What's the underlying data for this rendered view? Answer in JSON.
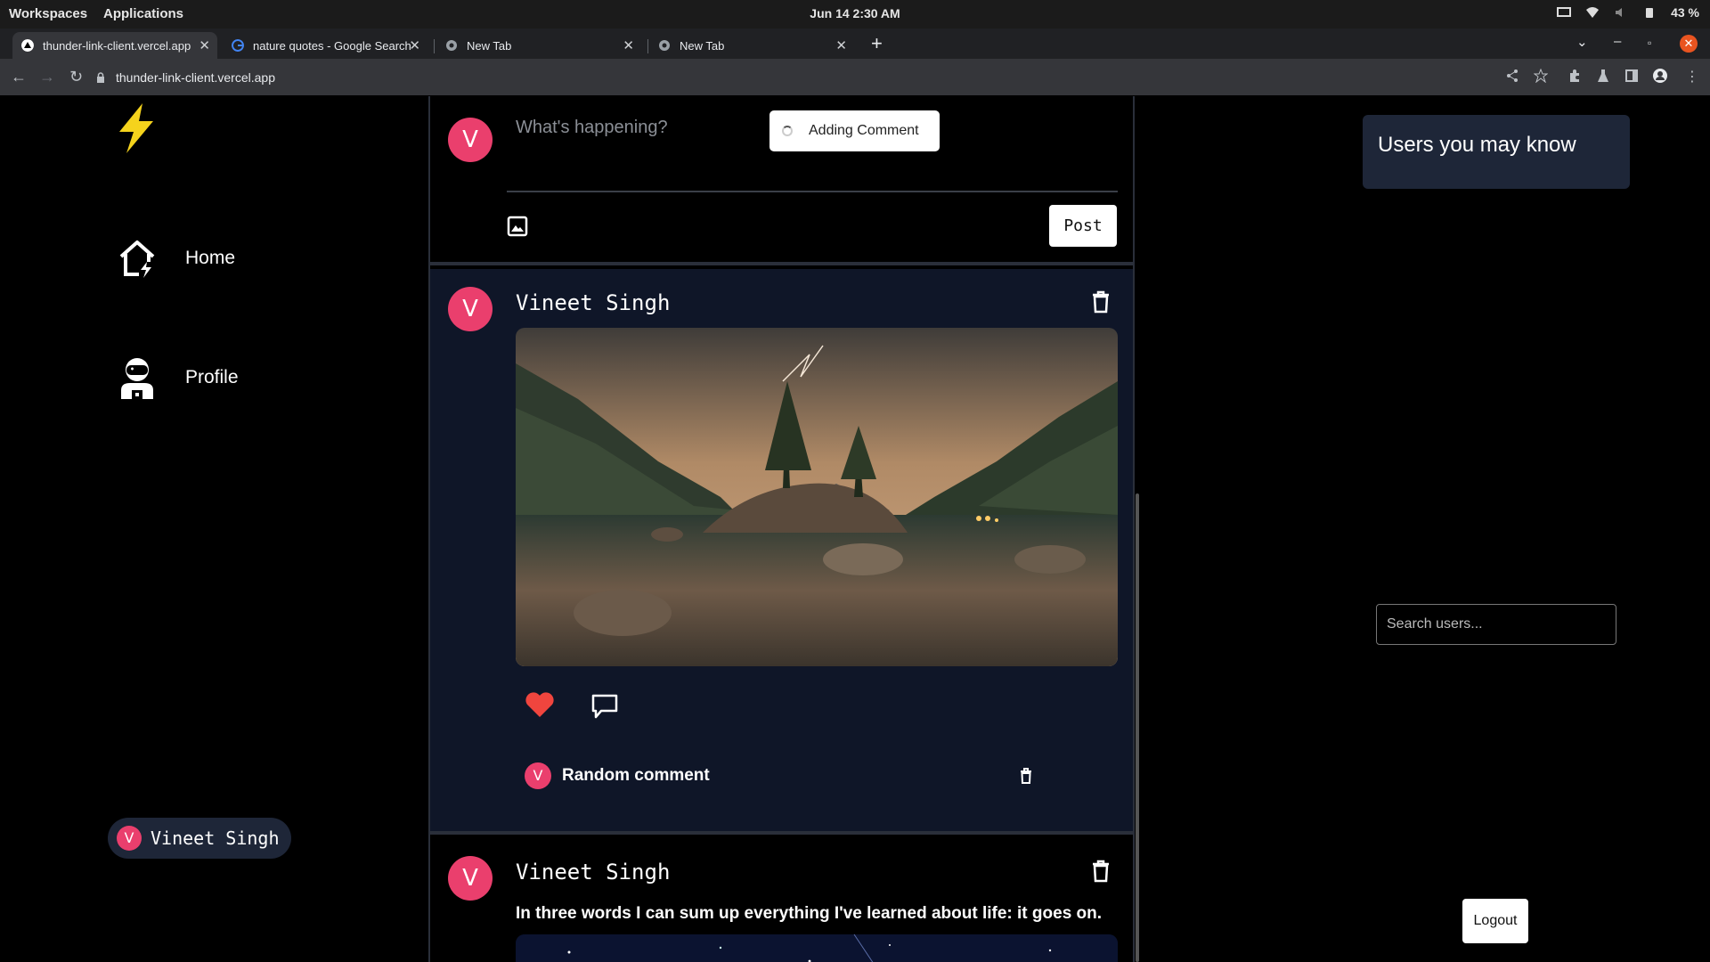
{
  "os_bar": {
    "workspaces": "Workspaces",
    "applications": "Applications",
    "clock": "Jun 14  2:30 AM",
    "battery": "43 %"
  },
  "browser": {
    "tabs": [
      {
        "title": "thunder-link-client.vercel.app",
        "active": true
      },
      {
        "title": "nature quotes - Google Search",
        "active": false
      },
      {
        "title": "New Tab",
        "active": false
      },
      {
        "title": "New Tab",
        "active": false
      }
    ],
    "url": "thunder-link-client.vercel.app"
  },
  "sidebar": {
    "items": [
      {
        "label": "Home",
        "icon": "home-bolt-icon"
      },
      {
        "label": "Profile",
        "icon": "astronaut-icon"
      }
    ],
    "current_user": {
      "initial": "V",
      "name": "Vineet Singh"
    }
  },
  "composer": {
    "avatar_initial": "V",
    "placeholder": "What's happening?",
    "post_label": "Post",
    "toast": "Adding Comment"
  },
  "posts": [
    {
      "avatar_initial": "V",
      "author": "Vineet Singh",
      "liked": true,
      "comments": [
        {
          "avatar_initial": "V",
          "text": "Random comment"
        }
      ]
    },
    {
      "avatar_initial": "V",
      "author": "Vineet Singh",
      "text": "In three words I can sum up everything I've learned about life: it goes on."
    }
  ],
  "right_panel": {
    "suggest_heading": "Users you may know",
    "search_placeholder": "Search users...",
    "logout_label": "Logout"
  },
  "colors": {
    "accent_pink": "#ea3f6d",
    "card_bg": "#0f1628",
    "logo_yellow": "#f5d31c",
    "heart_red": "#f0453e"
  }
}
